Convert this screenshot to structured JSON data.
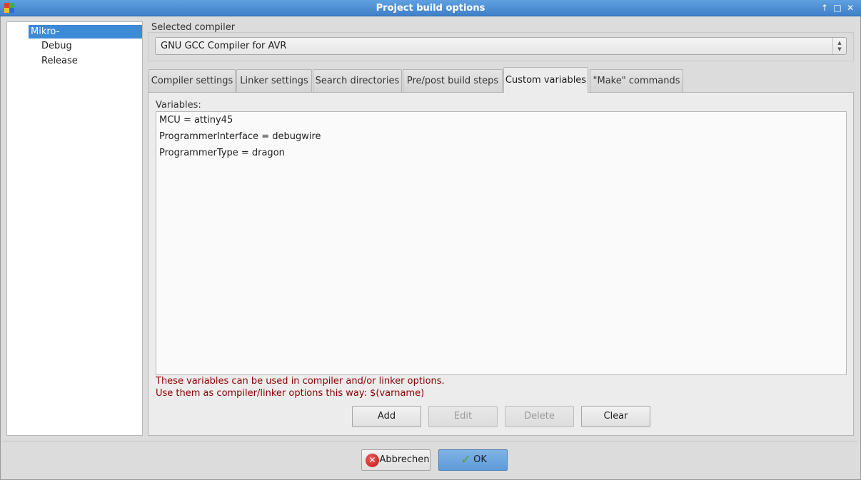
{
  "window": {
    "title": "Project build options",
    "controls": [
      "arrow-up-icon",
      "maximize-icon",
      "close-icon"
    ]
  },
  "tree": {
    "items": [
      {
        "label": "Mikro-Tiefentladeschutz",
        "selected": true
      },
      {
        "label": "Debug",
        "selected": false
      },
      {
        "label": "Release",
        "selected": false
      }
    ]
  },
  "compiler": {
    "group_label": "Selected compiler",
    "value": "GNU GCC Compiler for AVR"
  },
  "tabs": [
    {
      "label": "Compiler settings"
    },
    {
      "label": "Linker settings"
    },
    {
      "label": "Search directories"
    },
    {
      "label": "Pre/post build steps"
    },
    {
      "label": "Custom variables",
      "active": true
    },
    {
      "label": "\"Make\" commands"
    }
  ],
  "variables": {
    "label": "Variables:",
    "items": [
      "MCU = attiny45",
      "ProgrammerInterface = debugwire",
      "ProgrammerType = dragon"
    ],
    "note_line1": "These variables can be used in compiler and/or linker options.",
    "note_line2": "Use them as compiler/linker options this way: $(varname)"
  },
  "actions": {
    "add": "Add",
    "edit": "Edit",
    "delete": "Delete",
    "clear": "Clear"
  },
  "footer": {
    "cancel": "Abbrechen",
    "ok": "OK"
  },
  "colors": {
    "titlebar": "#4a8cd4",
    "selection": "#3d8ad6",
    "note": "#8b0000"
  }
}
